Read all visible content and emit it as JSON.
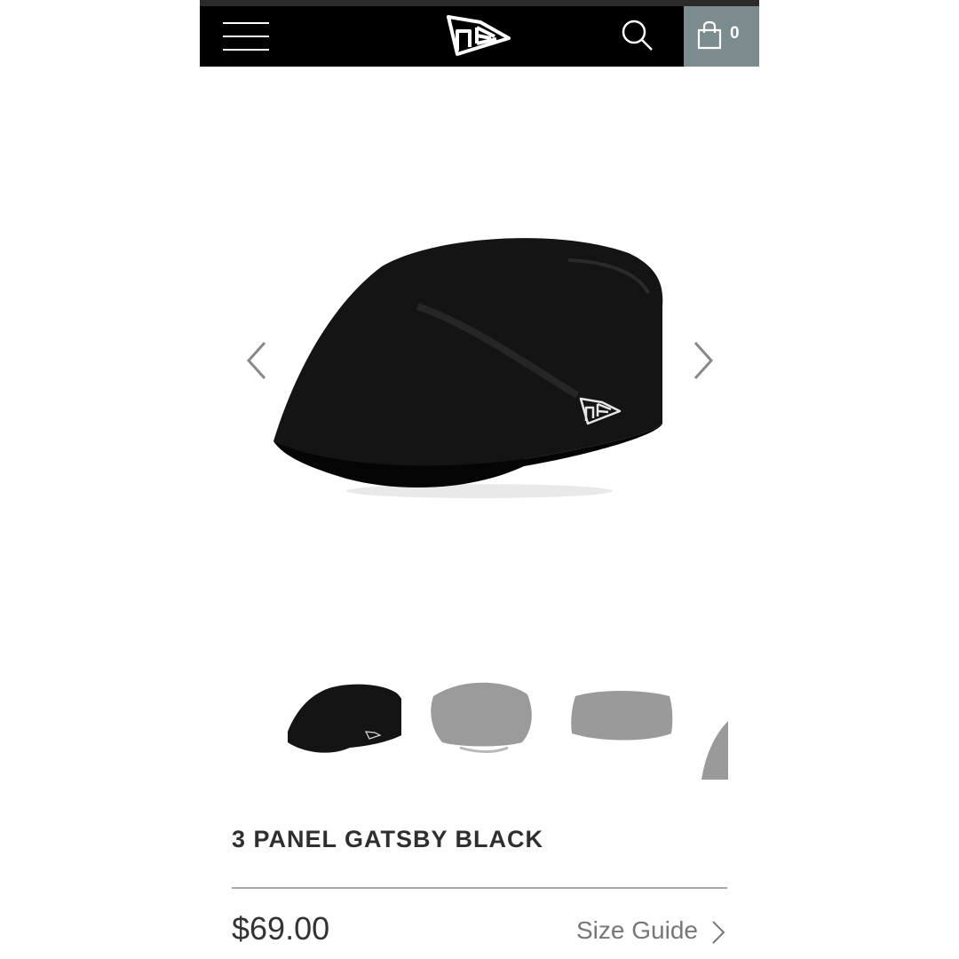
{
  "header": {
    "menu_icon": "hamburger-menu-icon",
    "logo_icon": "new-era-flag-logo",
    "search_icon": "search-icon",
    "cart_icon": "shopping-bag-icon",
    "cart_count": "0",
    "colors": {
      "header_bg": "#000000",
      "cart_bg": "#7c8b8d",
      "top_line": "#2b2b2b"
    }
  },
  "gallery": {
    "prev_icon": "chevron-left-icon",
    "next_icon": "chevron-right-icon",
    "main_image": "black-gatsby-cap-side-view",
    "thumbnails": [
      {
        "image": "black-gatsby-cap-side-view",
        "selected": true
      },
      {
        "image": "gray-cap-front-view",
        "selected": false
      },
      {
        "image": "gray-cap-back-view",
        "selected": false
      },
      {
        "image": "gray-cap-partial-view",
        "selected": false
      }
    ]
  },
  "product": {
    "title": "3 PANEL GATSBY BLACK",
    "price": "$69.00",
    "size_guide_label": "Size Guide",
    "size_guide_icon": "chevron-right-icon"
  }
}
